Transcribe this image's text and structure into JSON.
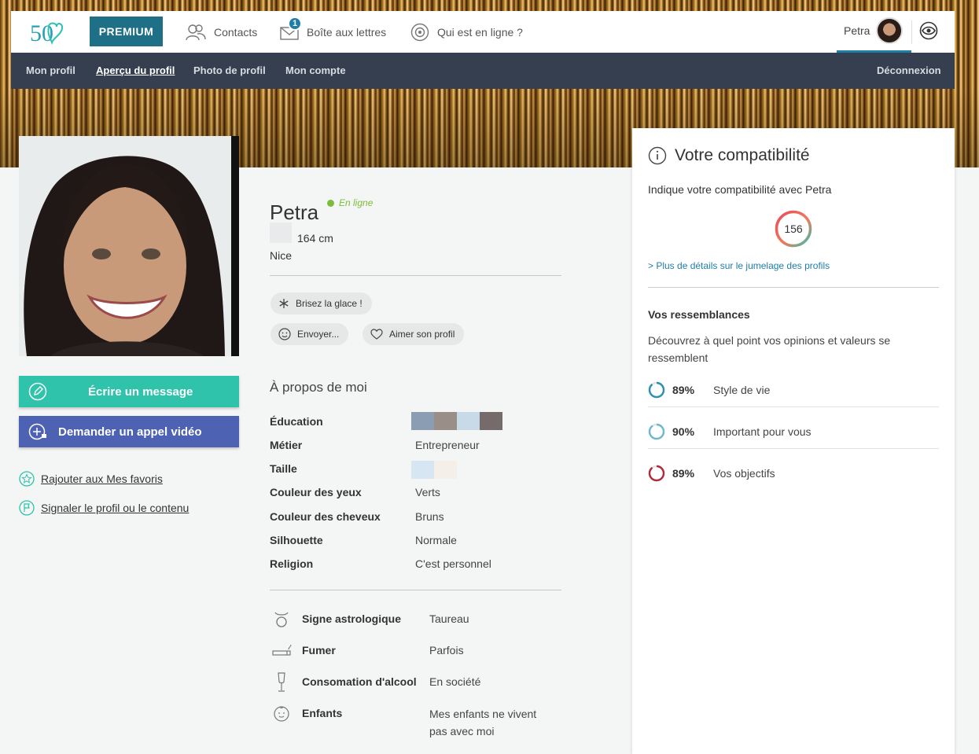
{
  "header": {
    "logo_text": "50",
    "premium_label": "PREMIUM",
    "nav": {
      "contacts": "Contacts",
      "mailbox": "Boîte aux lettres",
      "mailbox_badge": "1",
      "online": "Qui est en ligne ?"
    },
    "user_name": "Petra"
  },
  "subnav": {
    "items": [
      "Mon profil",
      "Aperçu du profil",
      "Photo de profil",
      "Mon compte"
    ],
    "active_index": 1,
    "logout": "Déconnexion"
  },
  "profile": {
    "name": "Petra",
    "status": "En ligne",
    "height": "164 cm",
    "city": "Nice",
    "actions": {
      "icebreaker": "Brisez la glace !",
      "send": "Envoyer...",
      "like": "Aimer son profil"
    },
    "buttons": {
      "message": "Écrire un message",
      "video_call": "Demander un appel vidéo"
    },
    "links": {
      "favorites": "Rajouter aux Mes favoris",
      "report": "Signaler le profil ou le contenu"
    }
  },
  "about": {
    "title": "À propos de moi",
    "attributes": [
      {
        "label": "Éducation",
        "value": ""
      },
      {
        "label": "Métier",
        "value": "Entrepreneur"
      },
      {
        "label": "Taille",
        "value": ""
      },
      {
        "label": "Couleur des yeux",
        "value": "Verts"
      },
      {
        "label": "Couleur des cheveux",
        "value": "Bruns"
      },
      {
        "label": "Silhouette",
        "value": "Normale"
      },
      {
        "label": "Religion",
        "value": "C'est personnel"
      }
    ],
    "education_swatches": [
      "#8a9db2",
      "#9a8e88",
      "#c8d9e8",
      "#756b6b"
    ],
    "height_swatches": [
      "#d6e6f2",
      "#f4efe8"
    ],
    "lifestyle": [
      {
        "icon": "zodiac-taurus-icon",
        "label": "Signe astrologique",
        "value": "Taureau"
      },
      {
        "icon": "cigarette-icon",
        "label": "Fumer",
        "value": "Parfois"
      },
      {
        "icon": "champagne-glass-icon",
        "label": "Consomation d'alcool",
        "value": "En société"
      },
      {
        "icon": "child-face-icon",
        "label": "Enfants",
        "value_line1": "Mes enfants ne vivent",
        "value_line2": "pas avec moi"
      }
    ]
  },
  "compatibility": {
    "title": "Votre compatibilité",
    "subtitle": "Indique votre compatibilité avec Petra",
    "score": "156",
    "details_link": "> Plus de détails sur le jumelage des profils",
    "resemblances_title": "Vos ressemblances",
    "resemblances_desc": "Découvrez à quel point vos opinions et valeurs se ressemblent",
    "items": [
      {
        "pct_value": 89,
        "pct": "89%",
        "label": "Style de vie",
        "color": "#2a8fb0"
      },
      {
        "pct_value": 90,
        "pct": "90%",
        "label": "Important pour vous",
        "color": "#6fb9cc"
      },
      {
        "pct_value": 89,
        "pct": "89%",
        "label": "Vos objectifs",
        "color": "#b02a3a"
      }
    ]
  },
  "colors": {
    "accent": "#1f7ea6",
    "premium": "#1f6f86",
    "message_button": "#2fc3ab",
    "video_button": "#4d62b3",
    "subnav": "#353f4f",
    "online": "#7bbd3a"
  }
}
